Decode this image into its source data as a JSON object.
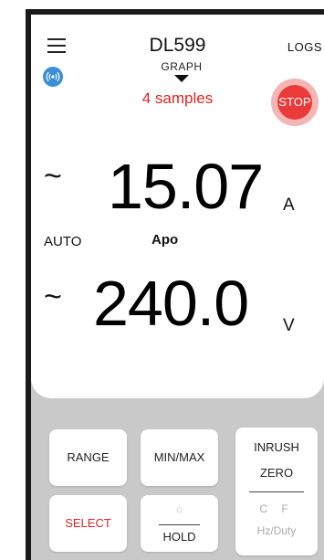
{
  "header": {
    "title": "DL599",
    "logs_label": "LOGS",
    "menu_icon": "hamburger-menu-icon"
  },
  "status": {
    "wireless_icon": "wireless-signal-icon",
    "graph_label": "GRAPH",
    "samples_text": "4 samples",
    "stop_label": "STOP"
  },
  "primary_reading": {
    "ac_symbol": "~",
    "value": "15.07",
    "unit": "A"
  },
  "mode": {
    "auto_label": "AUTO",
    "mode_label": "Apo"
  },
  "secondary_reading": {
    "ac_symbol": "~",
    "value": "240.0",
    "unit": "V"
  },
  "keypad": {
    "range_label": "RANGE",
    "minmax_label": "MIN/MAX",
    "select_label": "SELECT",
    "hold_label": "HOLD",
    "backlight_icon": "backlight-bulb-icon",
    "inrush_label": "INRUSH",
    "zero_label": "ZERO",
    "cf_label": "C F",
    "hz_duty_label": "Hz/Duty"
  },
  "colors": {
    "accent_red": "#e02424",
    "wireless_blue": "#3a8fd6",
    "keypad_bg": "#c9c9c9",
    "frame_dark": "#1a1a1a"
  }
}
